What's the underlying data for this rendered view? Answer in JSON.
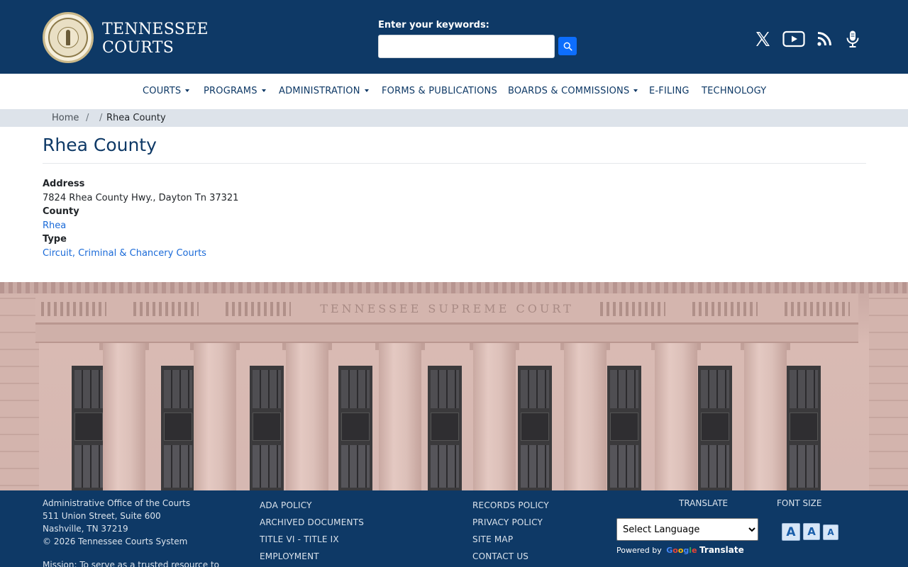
{
  "header": {
    "site_name_line1": "TENNESSEE",
    "site_name_line2": "COURTS",
    "search_label": "Enter your keywords:",
    "search_value": "",
    "social": [
      "x-icon",
      "youtube-icon",
      "rss-icon",
      "podcast-microphone-icon"
    ]
  },
  "nav": {
    "items": [
      {
        "label": "COURTS",
        "dropdown": true
      },
      {
        "label": "PROGRAMS",
        "dropdown": true
      },
      {
        "label": "ADMINISTRATION",
        "dropdown": true
      },
      {
        "label": "FORMS & PUBLICATIONS",
        "dropdown": false
      },
      {
        "label": "BOARDS & COMMISSIONS",
        "dropdown": true
      },
      {
        "label": "E-FILING",
        "dropdown": false
      },
      {
        "label": "TECHNOLOGY",
        "dropdown": false
      }
    ]
  },
  "breadcrumb": {
    "home": "Home",
    "sep1": "/",
    "sep2": "/",
    "current": "Rhea County"
  },
  "main": {
    "title": "Rhea County",
    "address_label": "Address",
    "address_value": "7824 Rhea County Hwy., Dayton Tn 37321",
    "county_label": "County",
    "county_value": "Rhea",
    "type_label": "Type",
    "type_value": "Circuit, Criminal & Chancery Courts"
  },
  "hero": {
    "inscription": "TENNESSEE SUPREME COURT"
  },
  "footer": {
    "address_lines": [
      "Administrative Office of the Courts",
      "511 Union Street, Suite 600",
      "Nashville, TN 37219",
      "© 2026 Tennessee Courts System"
    ],
    "mission": "Mission: To serve as a trusted resource to",
    "links_col1": [
      "ADA POLICY",
      "ARCHIVED DOCUMENTS",
      "TITLE VI - TITLE IX",
      "EMPLOYMENT"
    ],
    "links_col2": [
      "RECORDS POLICY",
      "PRIVACY POLICY",
      "SITE MAP",
      "CONTACT US"
    ],
    "translate_heading": "TRANSLATE",
    "language_select": "Select Language",
    "powered_by": "Powered by",
    "google": "Google",
    "translate_word": "Translate",
    "font_size_heading": "FONT SIZE",
    "font_buttons": [
      "A",
      "A",
      "A"
    ]
  },
  "colors": {
    "header_bg": "#0e3966",
    "link": "#1a6ad8",
    "search_button": "#0d6efd",
    "breadcrumb_bg": "#dde3ea"
  }
}
